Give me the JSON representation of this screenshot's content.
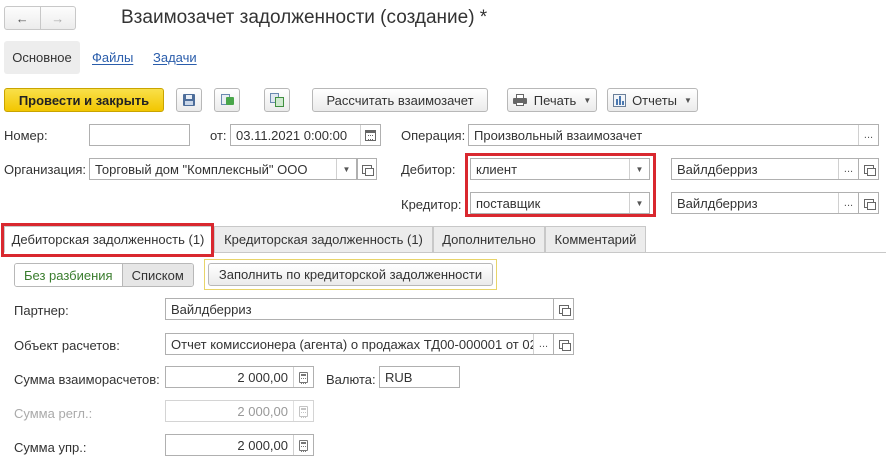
{
  "window": {
    "back_icon": "←",
    "forward_icon": "→",
    "title": "Взаимозачет задолженности (создание) *"
  },
  "nav": {
    "main": "Основное",
    "files": "Файлы",
    "tasks": "Задачи"
  },
  "toolbar": {
    "post_close": "Провести и закрыть",
    "calculate": "Рассчитать взаимозачет",
    "print": "Печать",
    "reports": "Отчеты",
    "icons": [
      "save-icon",
      "post-icon",
      "create-based-on-icon",
      "printer-icon",
      "reports-icon"
    ]
  },
  "header": {
    "number_label": "Номер:",
    "number_value": "",
    "date_from_label": "от:",
    "date_value": "03.11.2021  0:00:00",
    "operation_label": "Операция:",
    "operation_value": "Произвольный взаимозачет",
    "organization_label": "Организация:",
    "organization_value": "Торговый дом \"Комплексный\" ООО",
    "debtor_label": "Дебитор:",
    "debtor_type": "клиент",
    "debtor_value": "Вайлдберриз",
    "creditor_label": "Кредитор:",
    "creditor_type": "поставщик",
    "creditor_value": "Вайлдберриз"
  },
  "tabs": [
    {
      "label": "Дебиторская задолженность (1)",
      "active": true
    },
    {
      "label": "Кредиторская задолженность (1)",
      "active": false
    },
    {
      "label": "Дополнительно",
      "active": false
    },
    {
      "label": "Комментарий",
      "active": false
    }
  ],
  "tab_content": {
    "mode_split": "Без разбиения",
    "mode_list": "Списком",
    "fill_button": "Заполнить по кредиторской задолженности",
    "partner_label": "Партнер:",
    "partner_value": "Вайлдберриз",
    "settlement_object_label": "Объект расчетов:",
    "settlement_object_value": "Отчет комиссионера (агента) о продажах ТД00-000001 от 02",
    "amount_label": "Сумма взаиморасчетов:",
    "amount_value": "2 000,00",
    "currency_label": "Валюта:",
    "currency_value": "RUB",
    "amount_reg_label": "Сумма регл.:",
    "amount_reg_value": "2 000,00",
    "amount_mgmt_label": "Сумма упр.:",
    "amount_mgmt_value": "2 000,00"
  },
  "colors": {
    "primary_button": "#f2c600",
    "highlight_border": "#d9282f",
    "link": "#2a5dab",
    "active_mode": "#3a7d2e"
  }
}
